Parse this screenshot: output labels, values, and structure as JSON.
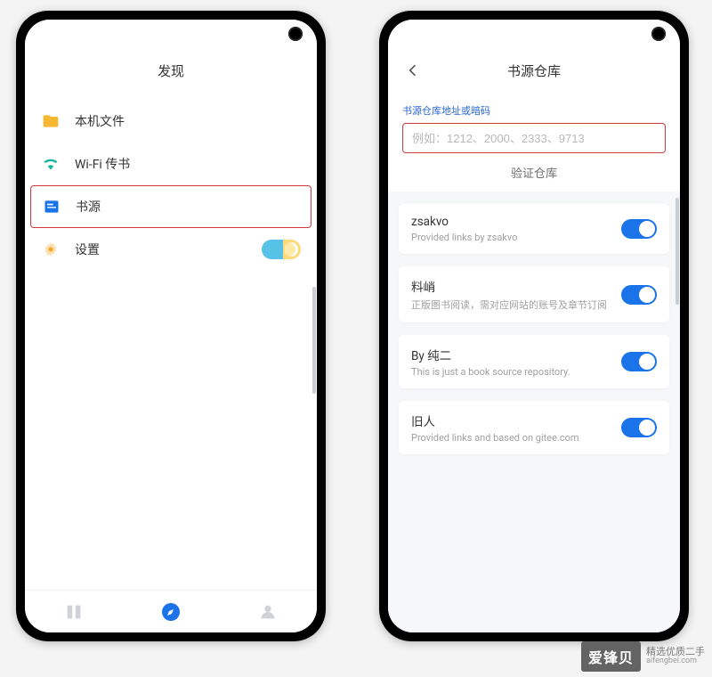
{
  "left": {
    "title": "发现",
    "rows": {
      "local": "本机文件",
      "wifi": "Wi-Fi 传书",
      "source": "书源",
      "settings": "设置"
    }
  },
  "right": {
    "title": "书源仓库",
    "form": {
      "label": "书源仓库地址或暗码",
      "placeholder": "例如：1212、2000、2333、9713",
      "verify": "验证仓库"
    },
    "repos": [
      {
        "title": "zsakvo",
        "sub": "Provided links by zsakvo"
      },
      {
        "title": "料峭",
        "sub": "正版图书阅读，需对应网站的账号及章节订阅"
      },
      {
        "title": "By 纯二",
        "sub": "This is just a book source repository."
      },
      {
        "title": "旧人",
        "sub": "Provided links and based on gitee.com"
      }
    ]
  },
  "watermark": {
    "brand": "爱锋贝",
    "line1": "精选优质二手",
    "line2": "aifengbei.com"
  }
}
